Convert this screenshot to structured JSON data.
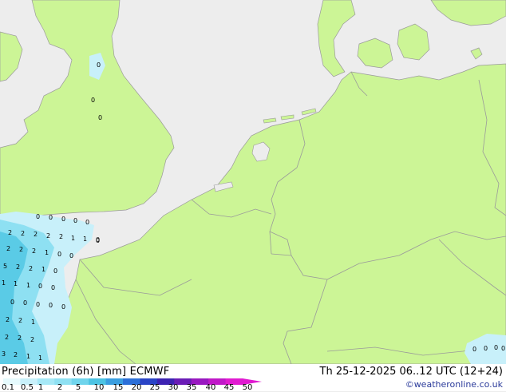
{
  "map": {
    "background_color": "#ededed",
    "land_color": "#ccf596",
    "border_color": "#9a9a9a",
    "precip_light_color": "#c8f0fa",
    "precip_mid_color": "#8ee0f2",
    "precip_heavy_color": "#5acbe6",
    "values": [
      {
        "id": "v-yorkshire",
        "text": "0"
      },
      {
        "id": "v-midlands-1",
        "text": "0"
      },
      {
        "id": "v-midlands-2",
        "text": "0"
      },
      {
        "id": "v-ch-1",
        "text": "0"
      },
      {
        "id": "v-ch-2",
        "text": "0"
      },
      {
        "id": "v-ch-3",
        "text": "0"
      },
      {
        "id": "v-ch-4",
        "text": "0"
      },
      {
        "id": "v-ch-5",
        "text": "0"
      },
      {
        "id": "v-ch-6",
        "text": "0"
      },
      {
        "id": "v-r2-1",
        "text": "2"
      },
      {
        "id": "v-r2-2",
        "text": "2"
      },
      {
        "id": "v-r2-3",
        "text": "2"
      },
      {
        "id": "v-r2-4",
        "text": "2"
      },
      {
        "id": "v-r2-5",
        "text": "2"
      },
      {
        "id": "v-r2-6",
        "text": "1"
      },
      {
        "id": "v-r2-7",
        "text": "1"
      },
      {
        "id": "v-r2-8",
        "text": "0"
      },
      {
        "id": "v-r3-1",
        "text": "2"
      },
      {
        "id": "v-r3-2",
        "text": "2"
      },
      {
        "id": "v-r3-3",
        "text": "2"
      },
      {
        "id": "v-r3-4",
        "text": "1"
      },
      {
        "id": "v-r3-5",
        "text": "0"
      },
      {
        "id": "v-r3-6",
        "text": "0"
      },
      {
        "id": "v-r4-1",
        "text": "5"
      },
      {
        "id": "v-r4-2",
        "text": "2"
      },
      {
        "id": "v-r4-3",
        "text": "2"
      },
      {
        "id": "v-r4-4",
        "text": "1"
      },
      {
        "id": "v-r4-5",
        "text": "0"
      },
      {
        "id": "v-r5-1",
        "text": "1"
      },
      {
        "id": "v-r5-2",
        "text": "1"
      },
      {
        "id": "v-r5-3",
        "text": "1"
      },
      {
        "id": "v-r5-4",
        "text": "0"
      },
      {
        "id": "v-r5-5",
        "text": "0"
      },
      {
        "id": "v-r6-1",
        "text": "0"
      },
      {
        "id": "v-r6-2",
        "text": "0"
      },
      {
        "id": "v-r6-3",
        "text": "0"
      },
      {
        "id": "v-r6-4",
        "text": "0"
      },
      {
        "id": "v-r6-5",
        "text": "0"
      },
      {
        "id": "v-r7-1",
        "text": "2"
      },
      {
        "id": "v-r7-2",
        "text": "2"
      },
      {
        "id": "v-r7-3",
        "text": "1"
      },
      {
        "id": "v-r8-1",
        "text": "2"
      },
      {
        "id": "v-r8-2",
        "text": "2"
      },
      {
        "id": "v-r8-3",
        "text": "2"
      },
      {
        "id": "v-r9-1",
        "text": "3"
      },
      {
        "id": "v-r9-2",
        "text": "2"
      },
      {
        "id": "v-r9-3",
        "text": "1"
      },
      {
        "id": "v-r9-4",
        "text": "1"
      },
      {
        "id": "v-se-1",
        "text": "0"
      },
      {
        "id": "v-se-2",
        "text": "0"
      },
      {
        "id": "v-se-3",
        "text": "0"
      },
      {
        "id": "v-se-4",
        "text": "0"
      }
    ]
  },
  "footer": {
    "title": "Precipitation (6h) [mm] ECMWF",
    "datetime": "Th 25-12-2025 06..12 UTC (12+24)",
    "credit": "©weatheronline.co.uk",
    "legend": {
      "labels": [
        "0.1",
        "0.5",
        "1",
        "2",
        "5",
        "10",
        "15",
        "20",
        "25",
        "30",
        "35",
        "40",
        "45",
        "50"
      ],
      "colors": [
        "#e6fafd",
        "#c8f0fa",
        "#a6e8f6",
        "#8ee0f2",
        "#6fd4ec",
        "#4cc3e3",
        "#3a9ee0",
        "#2c6fd8",
        "#2a44c6",
        "#3c22b2",
        "#6a1cb6",
        "#9818c0",
        "#c018c8",
        "#e01ad0"
      ]
    }
  }
}
